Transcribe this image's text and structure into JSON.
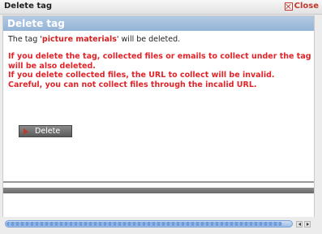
{
  "window": {
    "title": "Delete tag",
    "close_label": "Close"
  },
  "panel": {
    "title": "Delete tag",
    "message_prefix": "The tag '",
    "tag_name": "picture materials",
    "message_suffix": "' will be deleted.",
    "warning_lines": [
      "If you delete the tag, collected files or emails to collect under the tag will be also deleted.",
      "If you delete collected files, the URL to collect will be invalid. Careful, you can not collect files through the incalid URL."
    ],
    "delete_button_label": "Delete"
  },
  "scrollbar": {
    "position_fraction": 0.97
  },
  "colors": {
    "header_bg": "#9bb8d9",
    "warning_text": "#e0242a",
    "tag_name": "#d21f1f",
    "close_text": "#c0392b"
  },
  "icons": {
    "close": "close-icon",
    "delete": "play-icon"
  }
}
